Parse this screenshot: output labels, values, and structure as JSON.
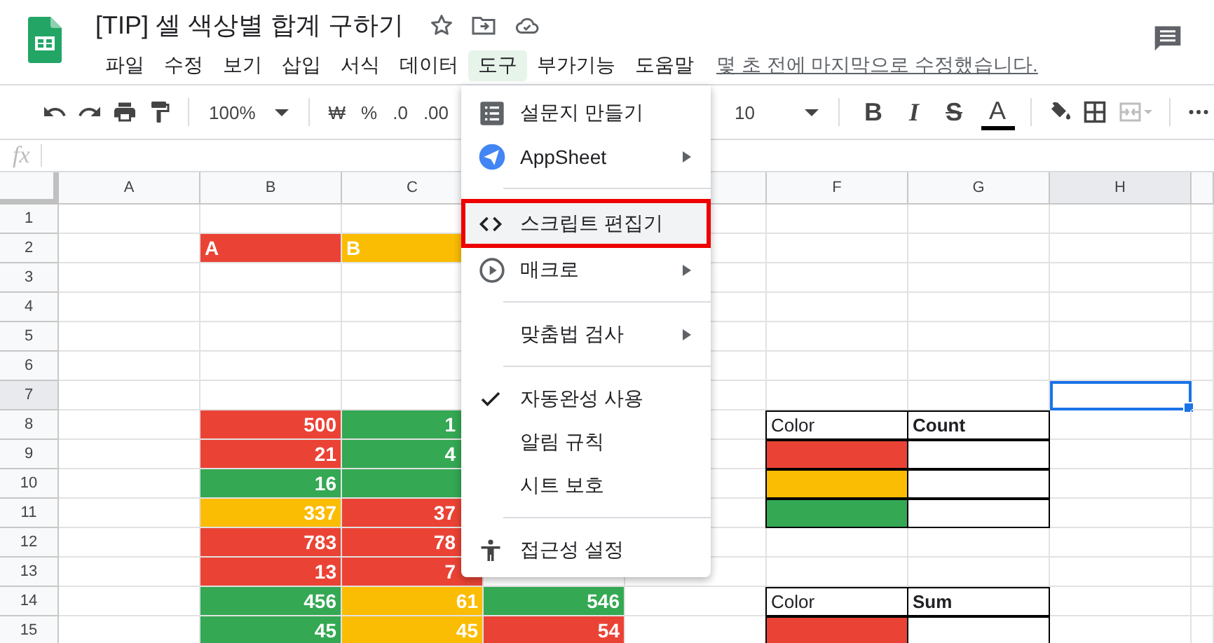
{
  "document": {
    "title": "[TIP] 셀 색상별 합계 구하기",
    "last_edit": "몇 초 전에 마지막으로 수정했습니다."
  },
  "menubar": [
    {
      "label": "파일",
      "selected": false
    },
    {
      "label": "수정",
      "selected": false
    },
    {
      "label": "보기",
      "selected": false
    },
    {
      "label": "삽입",
      "selected": false
    },
    {
      "label": "서식",
      "selected": false
    },
    {
      "label": "데이터",
      "selected": false
    },
    {
      "label": "도구",
      "selected": true
    },
    {
      "label": "부가기능",
      "selected": false
    },
    {
      "label": "도움말",
      "selected": false
    }
  ],
  "toolbar": {
    "zoom": "100%",
    "number_formats": [
      "₩",
      "%",
      ".0",
      ".00"
    ],
    "font_size": "10",
    "text_styles": [
      "B",
      "I",
      "S",
      "A"
    ],
    "merge_disabled": true
  },
  "formula_bar": {
    "label": "fx"
  },
  "columns": [
    {
      "label": "A",
      "selected": false
    },
    {
      "label": "B",
      "selected": false
    },
    {
      "label": "C",
      "selected": false
    },
    {},
    {},
    {
      "label": "F",
      "selected": false
    },
    {
      "label": "G",
      "selected": false
    },
    {
      "label": "H",
      "selected": true
    }
  ],
  "rows": [
    {
      "label": "1",
      "selected": false,
      "cells": [
        {},
        {},
        {},
        {},
        {},
        {},
        {},
        {}
      ]
    },
    {
      "label": "2",
      "selected": false,
      "cells": [
        {},
        {
          "text": "A",
          "color": "#ea4335",
          "kind": "label"
        },
        {
          "text": "B",
          "color": "#fbbc04",
          "kind": "label"
        },
        {},
        {},
        {},
        {},
        {}
      ]
    },
    {
      "label": "3",
      "selected": false,
      "cells": [
        {},
        {},
        {},
        {},
        {},
        {},
        {},
        {}
      ]
    },
    {
      "label": "4",
      "selected": false,
      "cells": [
        {},
        {},
        {},
        {},
        {},
        {},
        {},
        {}
      ]
    },
    {
      "label": "5",
      "selected": false,
      "cells": [
        {},
        {},
        {},
        {},
        {},
        {},
        {},
        {}
      ]
    },
    {
      "label": "6",
      "selected": false,
      "cells": [
        {},
        {},
        {},
        {},
        {},
        {},
        {},
        {}
      ]
    },
    {
      "label": "7",
      "selected": true,
      "cells": [
        {},
        {},
        {},
        {},
        {},
        {},
        {},
        {}
      ]
    },
    {
      "label": "8",
      "selected": false,
      "cells": [
        {},
        {
          "text": "500",
          "color": "#ea4335",
          "kind": "number"
        },
        {
          "text": "1",
          "color": "#34a853",
          "kind": "number",
          "clipped": true
        },
        {},
        {},
        {
          "text": "Color",
          "kind": "label",
          "bordered": true
        },
        {
          "text": "Count",
          "kind": "label",
          "bordered": true,
          "bold": true
        },
        {}
      ]
    },
    {
      "label": "9",
      "selected": false,
      "cells": [
        {},
        {
          "text": "21",
          "color": "#ea4335",
          "kind": "number"
        },
        {
          "text": "4",
          "color": "#34a853",
          "kind": "number",
          "clipped": true
        },
        {},
        {},
        {
          "color": "#ea4335",
          "bordered": true
        },
        {
          "bordered": true
        },
        {}
      ]
    },
    {
      "label": "10",
      "selected": false,
      "cells": [
        {},
        {
          "text": "16",
          "color": "#34a853",
          "kind": "number"
        },
        {
          "color": "#34a853"
        },
        {},
        {},
        {
          "color": "#fbbc04",
          "bordered": true
        },
        {
          "bordered": true
        },
        {}
      ]
    },
    {
      "label": "11",
      "selected": false,
      "cells": [
        {},
        {
          "text": "337",
          "color": "#fbbc04",
          "kind": "number"
        },
        {
          "text": "37",
          "color": "#ea4335",
          "kind": "number",
          "clipped": true
        },
        {},
        {},
        {
          "color": "#34a853",
          "bordered": true
        },
        {
          "bordered": true
        },
        {}
      ]
    },
    {
      "label": "12",
      "selected": false,
      "cells": [
        {},
        {
          "text": "783",
          "color": "#ea4335",
          "kind": "number"
        },
        {
          "text": "78",
          "color": "#ea4335",
          "kind": "number",
          "clipped": true
        },
        {},
        {},
        {},
        {},
        {}
      ]
    },
    {
      "label": "13",
      "selected": false,
      "cells": [
        {},
        {
          "text": "13",
          "color": "#ea4335",
          "kind": "number"
        },
        {
          "text": "7",
          "color": "#ea4335",
          "kind": "number",
          "clipped": true
        },
        {},
        {},
        {},
        {},
        {}
      ]
    },
    {
      "label": "14",
      "selected": false,
      "cells": [
        {},
        {
          "text": "456",
          "color": "#34a853",
          "kind": "number"
        },
        {
          "text": "61",
          "color": "#fbbc04",
          "kind": "number"
        },
        {
          "text": "546",
          "color": "#34a853",
          "kind": "number"
        },
        {},
        {
          "text": "Color",
          "kind": "label",
          "bordered": true
        },
        {
          "text": "Sum",
          "kind": "label",
          "bordered": true,
          "bold": true
        },
        {}
      ]
    },
    {
      "label": "15",
      "selected": false,
      "cells": [
        {},
        {
          "text": "45",
          "color": "#34a853",
          "kind": "number"
        },
        {
          "text": "45",
          "color": "#fbbc04",
          "kind": "number"
        },
        {
          "text": "54",
          "color": "#ea4335",
          "kind": "number"
        },
        {},
        {
          "color": "#ea4335",
          "bordered": true
        },
        {
          "bordered": true
        },
        {}
      ]
    }
  ],
  "tools_menu": {
    "groups": [
      [
        {
          "label": "설문지 만들기",
          "submenu": false,
          "checked": false,
          "selected": false
        },
        {
          "label": "AppSheet",
          "submenu": true,
          "checked": false,
          "selected": false
        }
      ],
      [
        {
          "label": "스크립트 편집기",
          "submenu": false,
          "checked": false,
          "selected": true
        },
        {
          "label": "매크로",
          "submenu": true,
          "checked": false,
          "selected": false
        }
      ],
      [
        {
          "label": "맞춤법 검사",
          "submenu": true,
          "checked": false,
          "selected": false
        }
      ],
      [
        {
          "label": "자동완성 사용",
          "submenu": false,
          "checked": true,
          "selected": false
        },
        {
          "label": "알림 규칙",
          "submenu": false,
          "checked": false,
          "selected": false
        },
        {
          "label": "시트 보호",
          "submenu": false,
          "checked": false,
          "selected": false
        }
      ],
      [
        {
          "label": "접근성 설정",
          "submenu": false,
          "checked": false,
          "selected": false
        }
      ]
    ]
  }
}
